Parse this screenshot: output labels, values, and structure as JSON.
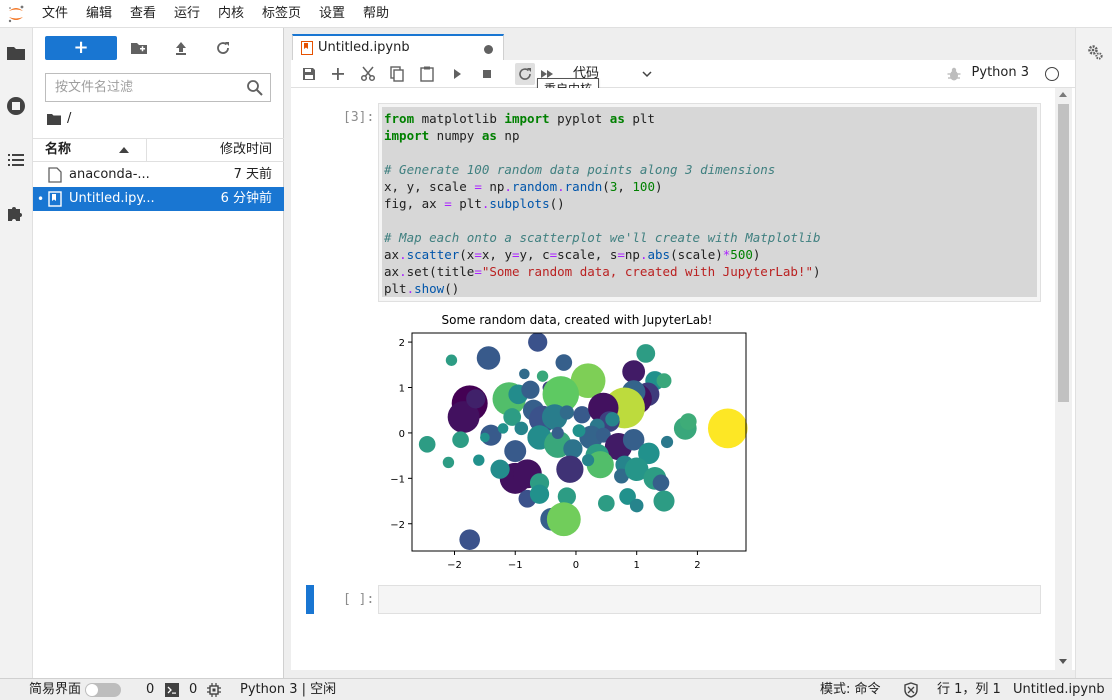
{
  "menubar": {
    "items": [
      "文件",
      "编辑",
      "查看",
      "运行",
      "内核",
      "标签页",
      "设置",
      "帮助"
    ]
  },
  "filebrowser": {
    "new_label": "+",
    "filter_placeholder": "按文件名过滤",
    "breadcrumb": "/",
    "col_name": "名称",
    "col_modified": "修改时间",
    "files": [
      {
        "name": "anaconda-...",
        "modified": "7 天前",
        "selected": false,
        "type": "file"
      },
      {
        "name": "Untitled.ipy...",
        "modified": "6 分钟前",
        "selected": true,
        "type": "notebook"
      }
    ]
  },
  "tab": {
    "title": "Untitled.ipynb"
  },
  "toolbar": {
    "cell_type": "代码",
    "kernel_name": "Python 3",
    "tooltip": "重启内核"
  },
  "cells": {
    "code_prompt": "[3]:",
    "empty_prompt": "[ ]:"
  },
  "chart_data": {
    "type": "scatter",
    "title": "Some random data, created with JupyterLab!",
    "xlabel": "",
    "ylabel": "",
    "xlim": [
      -2.7,
      2.8
    ],
    "ylim": [
      -2.6,
      2.2
    ],
    "xticks": [
      -2,
      -1,
      0,
      1,
      2
    ],
    "yticks": [
      -2,
      -1,
      0,
      1,
      2
    ],
    "xtick_labels": [
      "−2",
      "−1",
      "0",
      "1",
      "2"
    ],
    "ytick_labels": [
      "−2",
      "−1",
      "0",
      "1",
      "2"
    ],
    "colormap": "viridis",
    "points": [
      {
        "x": -1.44,
        "y": 1.65,
        "c": 0.28,
        "s": 300
      },
      {
        "x": -2.05,
        "y": 1.6,
        "c": 0.55,
        "s": 70
      },
      {
        "x": -0.63,
        "y": 2.0,
        "c": 0.25,
        "s": 200
      },
      {
        "x": -0.2,
        "y": 1.55,
        "c": 0.3,
        "s": 150
      },
      {
        "x": 0.2,
        "y": 1.35,
        "c": 0.35,
        "s": 110
      },
      {
        "x": 0.2,
        "y": 1.15,
        "c": 0.8,
        "s": 650
      },
      {
        "x": 0.95,
        "y": 1.35,
        "c": 0.08,
        "s": 280
      },
      {
        "x": 1.15,
        "y": 1.75,
        "c": 0.55,
        "s": 190
      },
      {
        "x": 1.3,
        "y": 1.15,
        "c": 0.5,
        "s": 200
      },
      {
        "x": 1.45,
        "y": 1.15,
        "c": 0.6,
        "s": 120
      },
      {
        "x": 1.18,
        "y": 0.85,
        "c": 0.18,
        "s": 300
      },
      {
        "x": 1.0,
        "y": 0.75,
        "c": 0.05,
        "s": 500
      },
      {
        "x": 0.95,
        "y": 0.9,
        "c": 0.32,
        "s": 300
      },
      {
        "x": 0.8,
        "y": 0.55,
        "c": 0.9,
        "s": 900
      },
      {
        "x": -1.75,
        "y": 0.65,
        "c": 0.0,
        "s": 700
      },
      {
        "x": -1.85,
        "y": 0.35,
        "c": 0.05,
        "s": 550
      },
      {
        "x": -1.65,
        "y": 0.75,
        "c": 0.1,
        "s": 200
      },
      {
        "x": -1.1,
        "y": 0.75,
        "c": 0.7,
        "s": 600
      },
      {
        "x": -0.95,
        "y": 0.85,
        "c": 0.48,
        "s": 210
      },
      {
        "x": -0.75,
        "y": 0.95,
        "c": 0.3,
        "s": 180
      },
      {
        "x": -0.45,
        "y": 1.0,
        "c": 0.2,
        "s": 80
      },
      {
        "x": -0.25,
        "y": 0.85,
        "c": 0.75,
        "s": 720
      },
      {
        "x": -0.7,
        "y": 0.5,
        "c": 0.3,
        "s": 240
      },
      {
        "x": -0.55,
        "y": 0.3,
        "c": 0.25,
        "s": 400
      },
      {
        "x": -0.35,
        "y": 0.35,
        "c": 0.42,
        "s": 350
      },
      {
        "x": -0.15,
        "y": 0.45,
        "c": 0.35,
        "s": 110
      },
      {
        "x": 0.1,
        "y": 0.4,
        "c": 0.28,
        "s": 160
      },
      {
        "x": 0.45,
        "y": 0.55,
        "c": 0.05,
        "s": 500
      },
      {
        "x": 0.55,
        "y": 0.25,
        "c": 0.2,
        "s": 230
      },
      {
        "x": 0.35,
        "y": 0.15,
        "c": 0.4,
        "s": 120
      },
      {
        "x": -1.05,
        "y": 0.35,
        "c": 0.55,
        "s": 170
      },
      {
        "x": -1.4,
        "y": -0.05,
        "c": 0.28,
        "s": 240
      },
      {
        "x": -1.5,
        "y": -0.1,
        "c": 0.5,
        "s": 50
      },
      {
        "x": -1.9,
        "y": -0.15,
        "c": 0.55,
        "s": 150
      },
      {
        "x": -2.45,
        "y": -0.25,
        "c": 0.55,
        "s": 150
      },
      {
        "x": -1.0,
        "y": -0.4,
        "c": 0.28,
        "s": 260
      },
      {
        "x": -0.6,
        "y": -0.1,
        "c": 0.48,
        "s": 320
      },
      {
        "x": -0.3,
        "y": -0.25,
        "c": 0.6,
        "s": 400
      },
      {
        "x": -0.05,
        "y": -0.35,
        "c": 0.38,
        "s": 200
      },
      {
        "x": 0.25,
        "y": -0.1,
        "c": 0.32,
        "s": 300
      },
      {
        "x": 0.45,
        "y": -0.05,
        "c": 0.3,
        "s": 120
      },
      {
        "x": 0.7,
        "y": -0.3,
        "c": 0.08,
        "s": 400
      },
      {
        "x": 0.95,
        "y": -0.15,
        "c": 0.3,
        "s": 250
      },
      {
        "x": 0.35,
        "y": -0.5,
        "c": 0.55,
        "s": 300
      },
      {
        "x": 0.4,
        "y": -0.7,
        "c": 0.7,
        "s": 400
      },
      {
        "x": 1.2,
        "y": -0.45,
        "c": 0.5,
        "s": 250
      },
      {
        "x": 1.5,
        "y": -0.2,
        "c": 0.4,
        "s": 80
      },
      {
        "x": 1.8,
        "y": 0.1,
        "c": 0.6,
        "s": 280
      },
      {
        "x": 1.85,
        "y": 0.25,
        "c": 0.62,
        "s": 150
      },
      {
        "x": 2.5,
        "y": 0.1,
        "c": 1.0,
        "s": 850
      },
      {
        "x": -1.0,
        "y": -1.0,
        "c": 0.05,
        "s": 520
      },
      {
        "x": -0.8,
        "y": -0.9,
        "c": 0.05,
        "s": 450
      },
      {
        "x": -0.6,
        "y": -1.1,
        "c": 0.55,
        "s": 200
      },
      {
        "x": -0.1,
        "y": -0.8,
        "c": 0.15,
        "s": 400
      },
      {
        "x": 0.2,
        "y": -0.6,
        "c": 0.45,
        "s": 80
      },
      {
        "x": 0.8,
        "y": -0.7,
        "c": 0.45,
        "s": 180
      },
      {
        "x": 0.75,
        "y": -0.95,
        "c": 0.35,
        "s": 120
      },
      {
        "x": 1.0,
        "y": -0.8,
        "c": 0.52,
        "s": 300
      },
      {
        "x": 1.3,
        "y": -1.0,
        "c": 0.55,
        "s": 280
      },
      {
        "x": 1.4,
        "y": -1.1,
        "c": 0.3,
        "s": 150
      },
      {
        "x": -2.1,
        "y": -0.65,
        "c": 0.55,
        "s": 70
      },
      {
        "x": -1.6,
        "y": -0.6,
        "c": 0.5,
        "s": 70
      },
      {
        "x": -1.25,
        "y": -0.8,
        "c": 0.48,
        "s": 200
      },
      {
        "x": -0.8,
        "y": -1.45,
        "c": 0.25,
        "s": 170
      },
      {
        "x": -0.6,
        "y": -1.35,
        "c": 0.5,
        "s": 200
      },
      {
        "x": -0.15,
        "y": -1.4,
        "c": 0.55,
        "s": 180
      },
      {
        "x": 0.5,
        "y": -1.55,
        "c": 0.55,
        "s": 150
      },
      {
        "x": 0.85,
        "y": -1.4,
        "c": 0.5,
        "s": 150
      },
      {
        "x": 1.0,
        "y": -1.6,
        "c": 0.45,
        "s": 100
      },
      {
        "x": 1.45,
        "y": -1.5,
        "c": 0.55,
        "s": 240
      },
      {
        "x": -0.4,
        "y": -1.9,
        "c": 0.3,
        "s": 280
      },
      {
        "x": -0.2,
        "y": -1.9,
        "c": 0.78,
        "s": 620
      },
      {
        "x": -1.75,
        "y": -2.35,
        "c": 0.25,
        "s": 230
      },
      {
        "x": -0.85,
        "y": 1.3,
        "c": 0.35,
        "s": 60
      },
      {
        "x": -0.55,
        "y": 1.25,
        "c": 0.6,
        "s": 70
      },
      {
        "x": -1.2,
        "y": 0.1,
        "c": 0.5,
        "s": 60
      },
      {
        "x": -0.9,
        "y": 0.1,
        "c": 0.45,
        "s": 100
      },
      {
        "x": 0.6,
        "y": 0.3,
        "c": 0.45,
        "s": 110
      },
      {
        "x": 0.05,
        "y": 0.05,
        "c": 0.5,
        "s": 90
      },
      {
        "x": -0.3,
        "y": 0.0,
        "c": 0.3,
        "s": 80
      }
    ]
  },
  "status": {
    "simple_mode": "简易界面",
    "count1": "0",
    "count2": "0",
    "kernel_status": "Python 3 | 空闲",
    "mode": "模式: 命令",
    "position": "行 1，列 1",
    "filename": "Untitled.ipynb"
  }
}
